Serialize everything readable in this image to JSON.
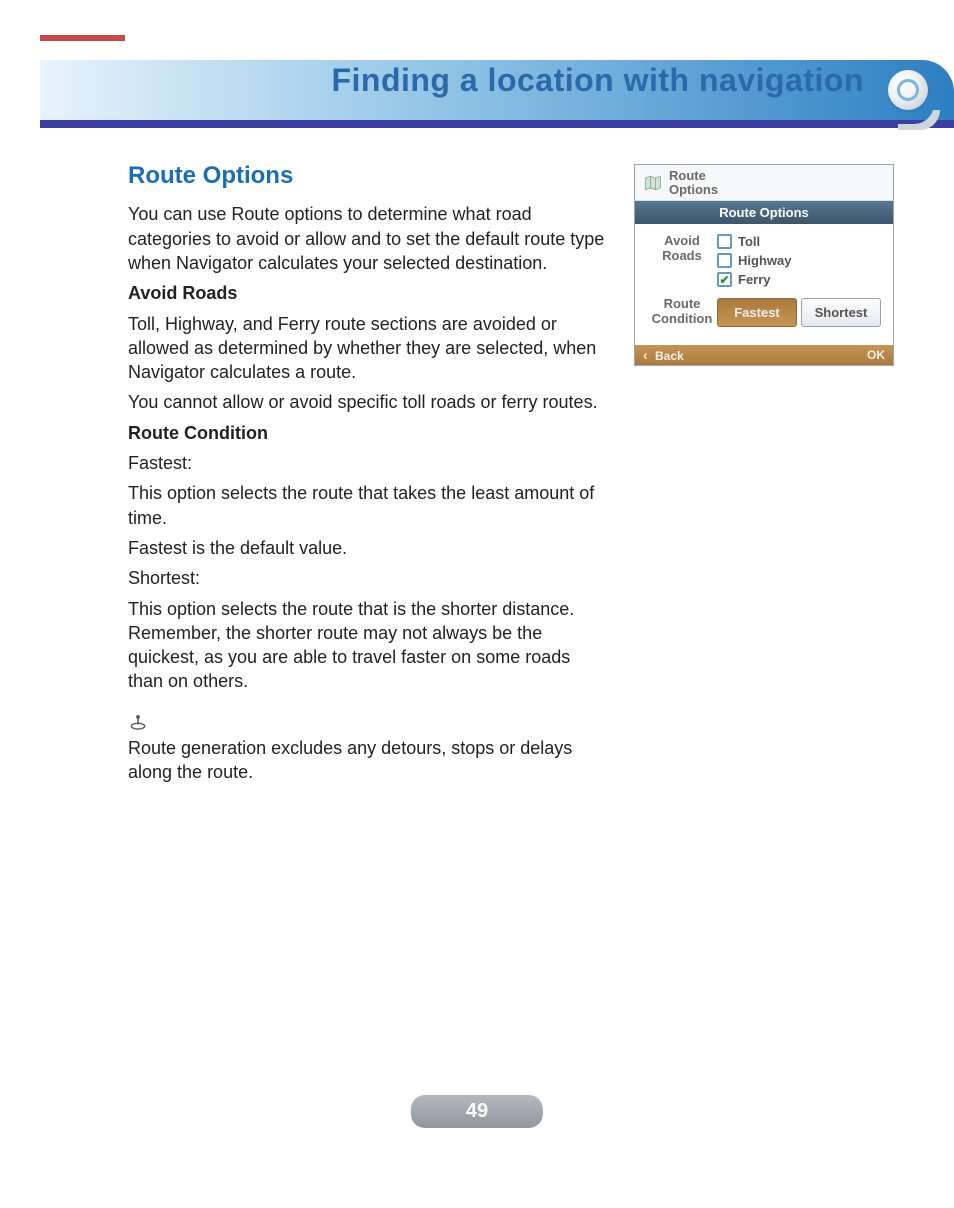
{
  "header": {
    "title": "Finding a location with navigation"
  },
  "content": {
    "h2": "Route Options",
    "intro": "You can use Route options to determine what road categories to avoid or allow and to set the default route type when Navigator calculates your selected destination.",
    "avoid_heading": "Avoid Roads",
    "avoid_p1": "Toll, Highway, and Ferry route sections are avoided or allowed as determined by whether they are selected, when Navigator calculates a route.",
    "avoid_p2": "You cannot allow or avoid specific toll roads or ferry routes.",
    "rc_heading": "Route Condition",
    "fastest_label": "Fastest:",
    "fastest_p1": "This option selects the route that takes the least amount of time.",
    "fastest_p2": "Fastest is the default value.",
    "shortest_label": "Shortest:",
    "shortest_p": "This option selects the route that is the shorter distance. Remember, the shorter route may not always be the quickest, as you are able to travel faster on some roads than on others.",
    "note": "Route generation excludes any detours, stops or delays along the route."
  },
  "screenshot": {
    "window_title_line1": "Route",
    "window_title_line2": "Options",
    "titlebar": "Route Options",
    "avoid_label_line1": "Avoid",
    "avoid_label_line2": "Roads",
    "checkboxes": [
      {
        "label": "Toll",
        "checked": false
      },
      {
        "label": "Highway",
        "checked": false
      },
      {
        "label": "Ferry",
        "checked": true
      }
    ],
    "route_condition_label_line1": "Route",
    "route_condition_label_line2": "Condition",
    "buttons": {
      "fastest": "Fastest",
      "shortest": "Shortest",
      "active": "fastest"
    },
    "back": "Back",
    "ok": "OK"
  },
  "page_number": "49"
}
